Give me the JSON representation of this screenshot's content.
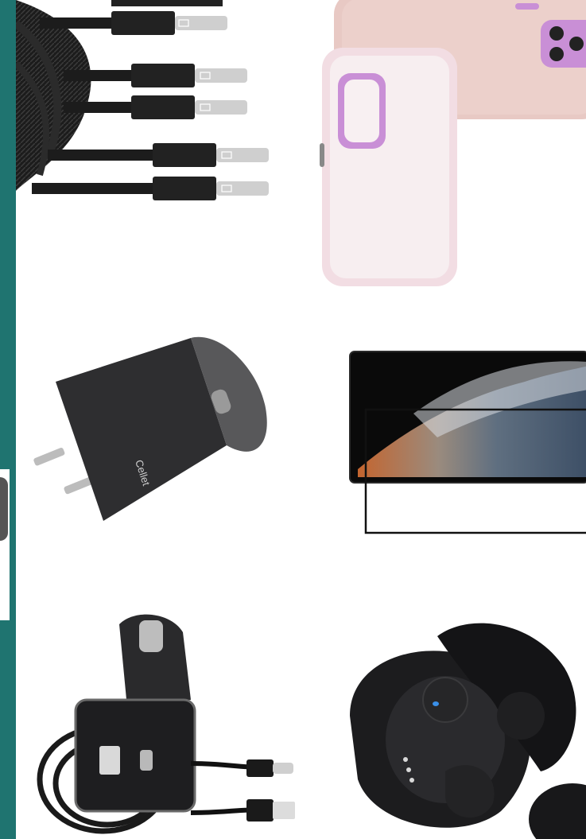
{
  "colors": {
    "accent": "#1f7470",
    "cable_black": "#1c1c1c",
    "case_pink": "#e8c9c4",
    "case_rim": "#f2d9e3",
    "lens_purple": "#c98fd6",
    "charger_gray": "#3a3a3c"
  },
  "products": {
    "cables": {
      "icon": "usb-c-cable-icon",
      "count": 6
    },
    "case": {
      "icon": "phone-case-icon"
    },
    "wall_charger": {
      "icon": "wall-charger-icon",
      "brand": "Cellet"
    },
    "screen_protector": {
      "icon": "screen-protector-icon"
    },
    "car_charger": {
      "icon": "car-charger-icon"
    },
    "earbuds": {
      "icon": "earbuds-icon"
    }
  }
}
